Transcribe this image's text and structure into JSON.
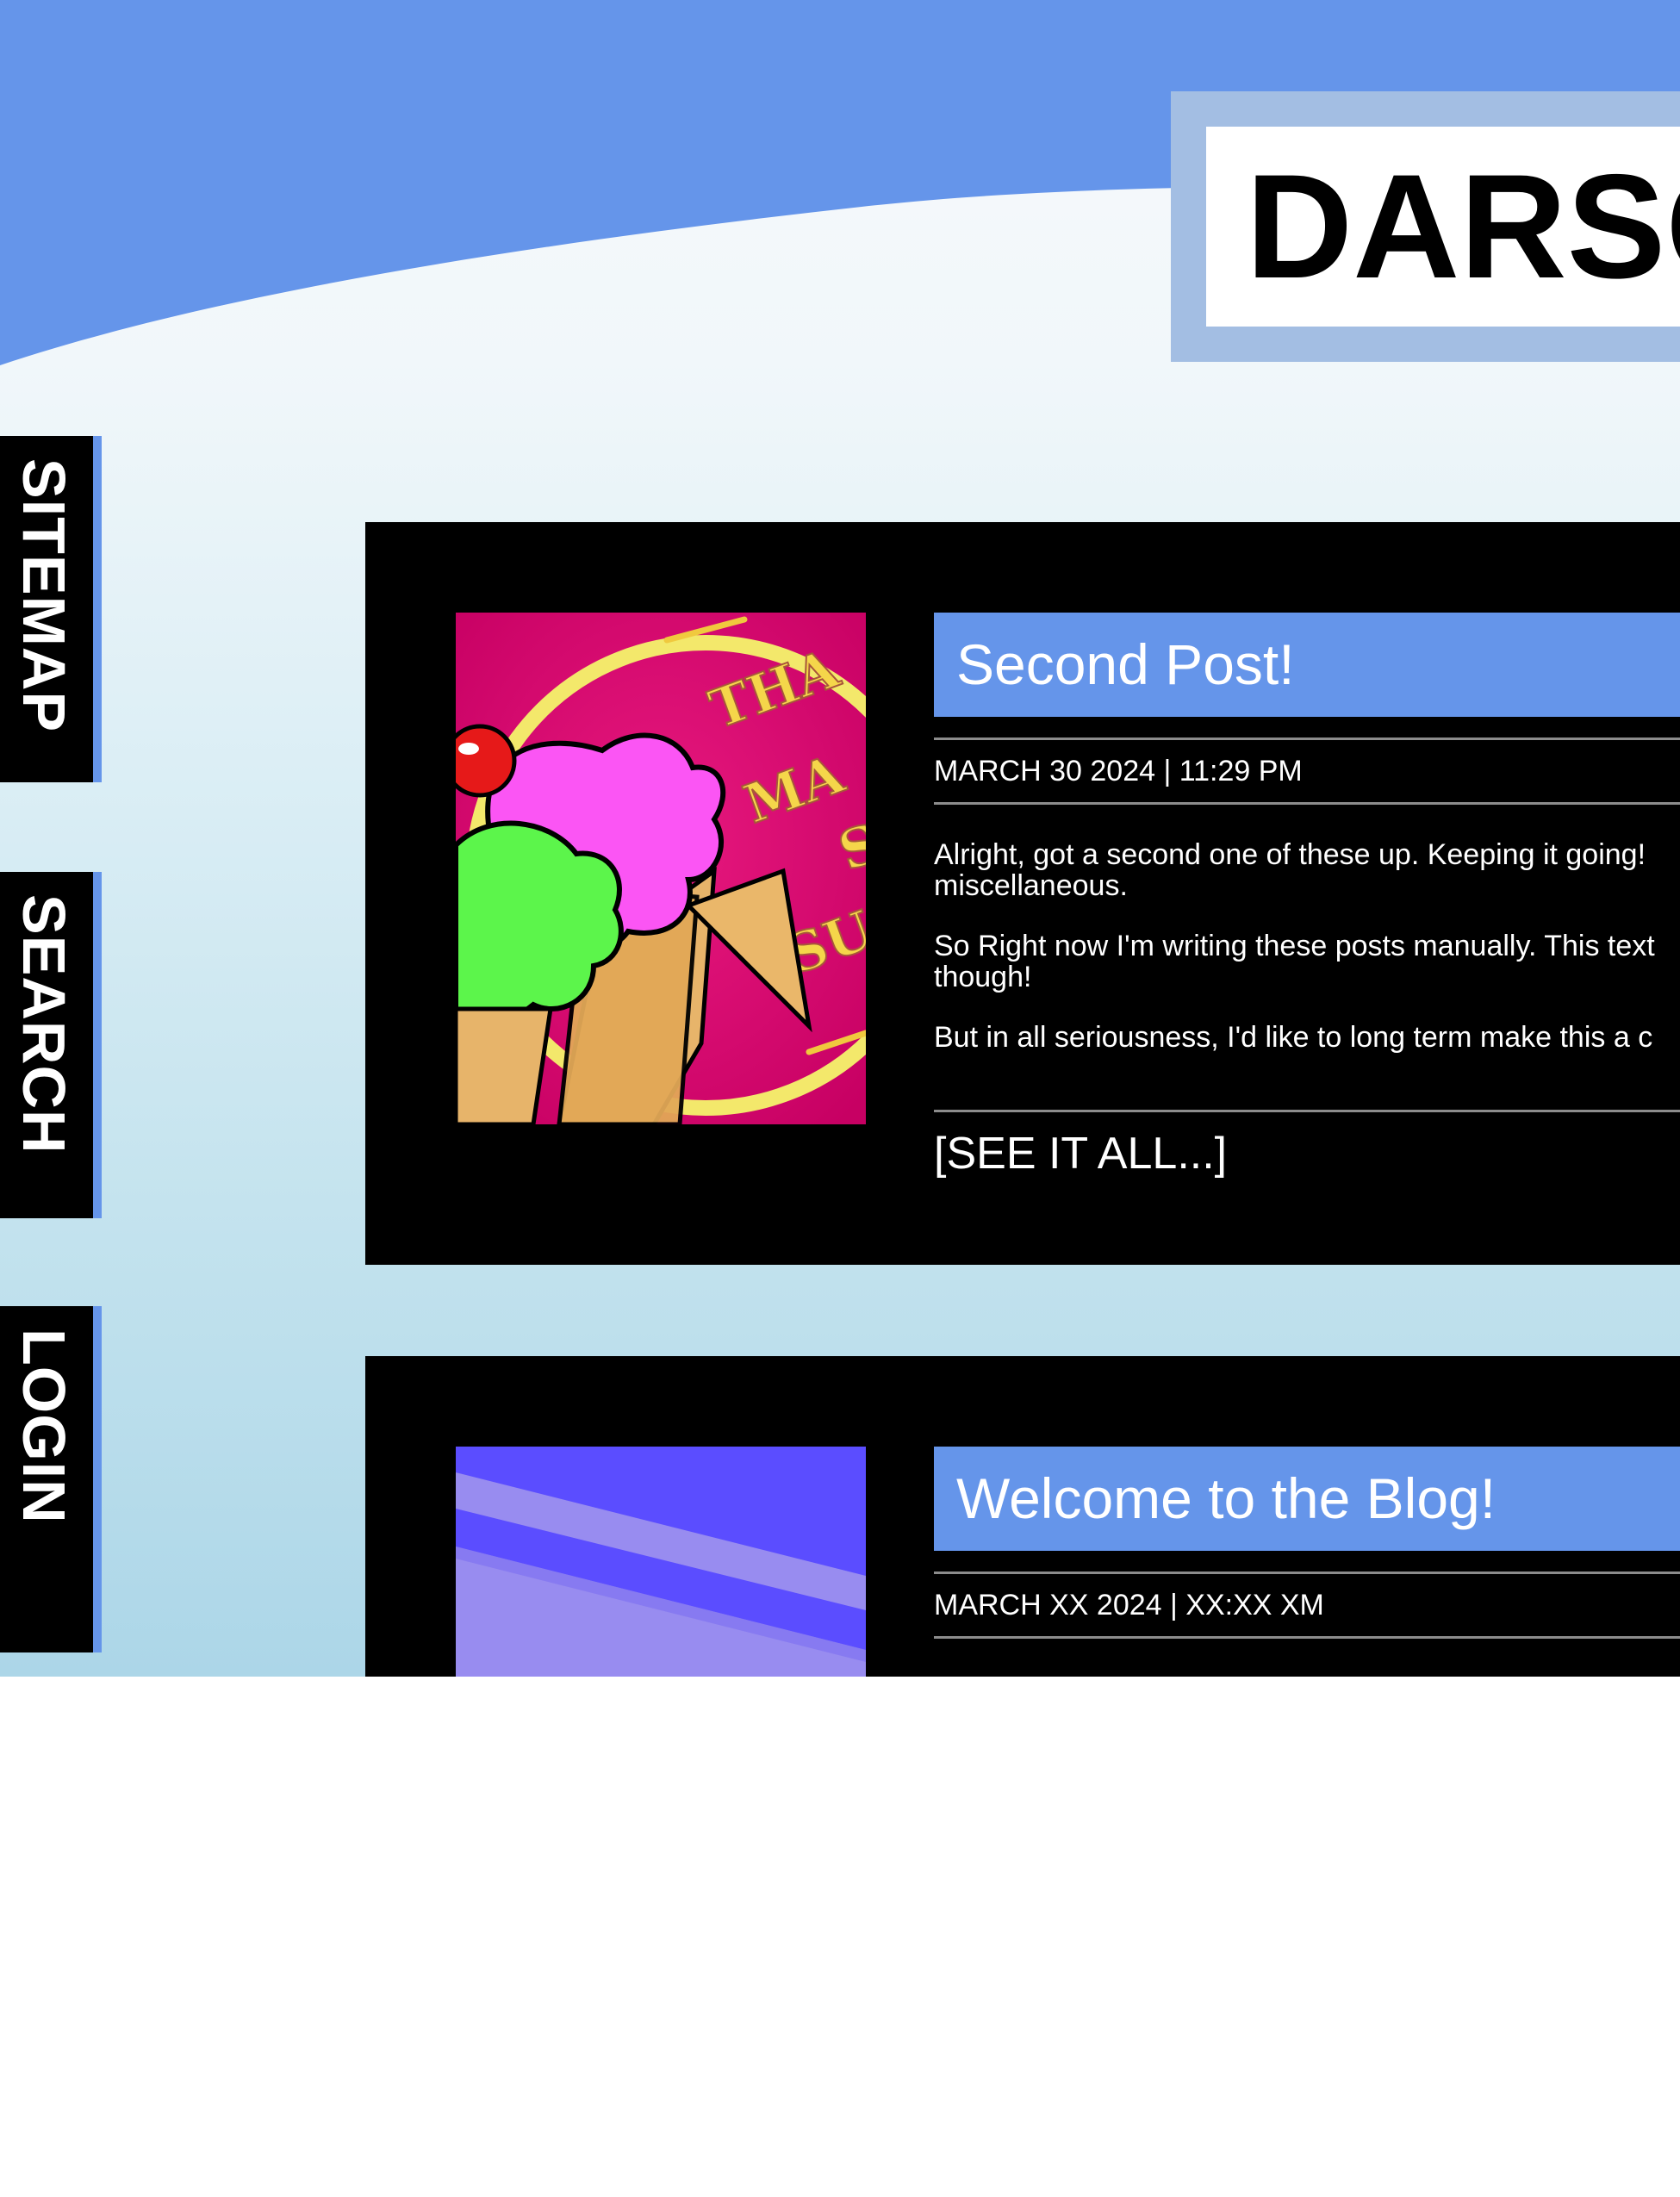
{
  "header": {
    "site_title": "DARSC",
    "sky_color": "#6595ea",
    "title_frame_color": "#a3bee3"
  },
  "side_nav": {
    "accent_color": "#6595ea",
    "items": [
      {
        "label": "SITEMAP"
      },
      {
        "label": "SEARCH"
      },
      {
        "label": "LOGIN"
      }
    ]
  },
  "posts": [
    {
      "title": "Second Post!",
      "date": "MARCH 30 2024 | 11:29 PM",
      "image_icon": "ice-cream-badge-icon",
      "paragraphs": [
        "Alright, got a second one of these up. Keeping it going!",
        "miscellaneous.",
        "So Right now I'm writing these posts manually. This text",
        "though!",
        "But in all seriousness, I'd like to long term make this a c"
      ],
      "image_text": [
        "THA",
        "MA",
        "S",
        "SU"
      ],
      "see_all_label": "[SEE IT ALL...]"
    },
    {
      "title": "Welcome to the Blog!",
      "date": "MARCH XX 2024 | XX:XX XM",
      "image_icon": "purple-stripes-thumbnail-icon"
    }
  ]
}
